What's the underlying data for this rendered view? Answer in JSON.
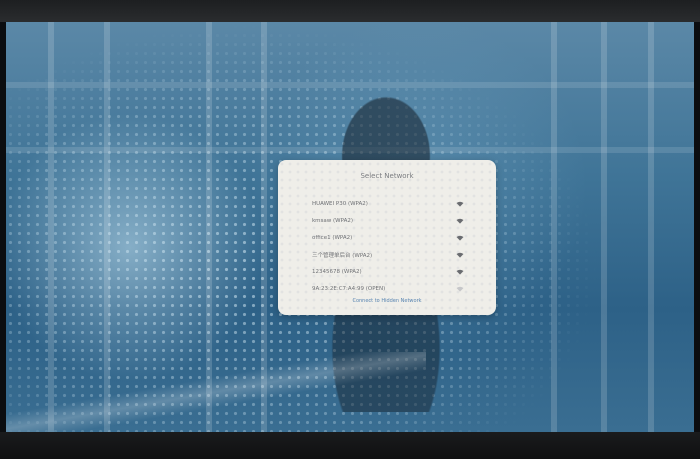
{
  "dialog": {
    "title": "Select Network",
    "networks": [
      {
        "name": "HUAWEI P30 (WPA2)",
        "icon": "wifi-icon",
        "secured": true
      },
      {
        "name": "kmsaw (WPA2)",
        "icon": "wifi-icon",
        "secured": true
      },
      {
        "name": "office1 (WPA2)",
        "icon": "wifi-icon",
        "secured": true
      },
      {
        "name": "三个管理单后台 (WPA2)",
        "icon": "wifi-icon",
        "secured": true
      },
      {
        "name": "12345678 (WPA2)",
        "icon": "wifi-icon",
        "secured": true
      },
      {
        "name": "9A:23:2E:C7:A4:99 (OPEN)",
        "icon": "wifi-icon",
        "secured": false
      }
    ],
    "other_link": "Connect to Hidden Network"
  },
  "colors": {
    "dialog_bg": "#efeee9",
    "link": "#5b87b3",
    "screen_bg": "#3f7497"
  }
}
